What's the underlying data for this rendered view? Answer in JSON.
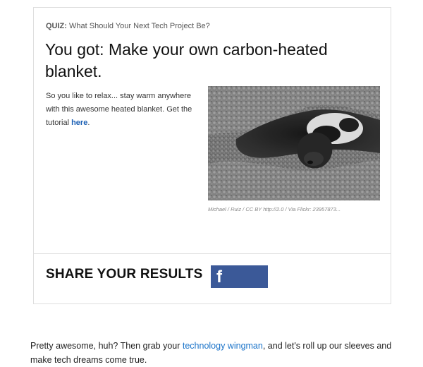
{
  "quiz": {
    "prefix": "QUIZ:",
    "title": "What Should Your Next Tech Project Be?"
  },
  "result": {
    "title": "You got: Make your own carbon-heated blanket.",
    "description_text": "So you like to relax... stay warm anywhere with this awesome heated blanket. Get the tutorial ",
    "link_text": "here",
    "description_end": "."
  },
  "photo": {
    "alt": "Puppy sleeping under a fluffy blanket",
    "credit": "Michael / Ruiz / CC BY http://2.0 / Via Flickr: 23957873..."
  },
  "share": {
    "heading": "SHARE YOUR RESULTS",
    "facebook_icon": "f"
  },
  "footer": {
    "text_before": "Pretty awesome, huh? Then grab your ",
    "link_text": "technology wingman",
    "text_after": ", and let's roll up our sleeves and make tech dreams come true."
  },
  "colors": {
    "facebook": "#3b5998",
    "link": "#1a5fb4",
    "border": "#dedede"
  },
  "icons": [
    "facebook-icon"
  ]
}
